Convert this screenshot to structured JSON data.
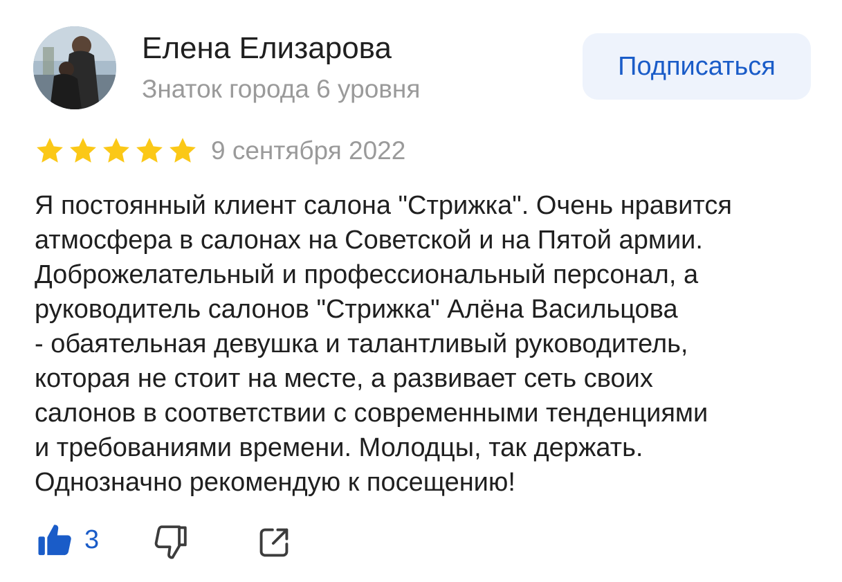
{
  "author": {
    "name": "Елена Елизарова",
    "level": "Знаток города 6 уровня",
    "avatar_icon": "user-photo"
  },
  "subscribe_button": {
    "label": "Подписаться"
  },
  "review": {
    "rating": 5,
    "max_rating": 5,
    "date": "9 сентября 2022",
    "text_lines": [
      "Я постоянный клиент салона \"Стрижка\". Очень нравится",
      "атмосфера в салонах на Советской и на Пятой армии.",
      "Доброжелательный и профессиональный персонал, а",
      "руководитель салонов \"Стрижка\" Алёна Васильцова",
      "- обаятельная девушка и талантливый руководитель,",
      "которая не стоит на месте, а развивает сеть своих",
      "салонов в соответствии с современными тенденциями",
      "и требованиями времени. Молодцы, так держать.",
      "Однозначно рекомендую к посещению!"
    ]
  },
  "actions": {
    "like_count": "3",
    "like_icon": "thumbs-up-icon",
    "dislike_icon": "thumbs-down-icon",
    "share_icon": "share-icon"
  },
  "colors": {
    "accent": "#1a5cc8",
    "star": "#fbc817",
    "muted_text": "#9a9a9a",
    "button_bg": "#eef3fc"
  }
}
